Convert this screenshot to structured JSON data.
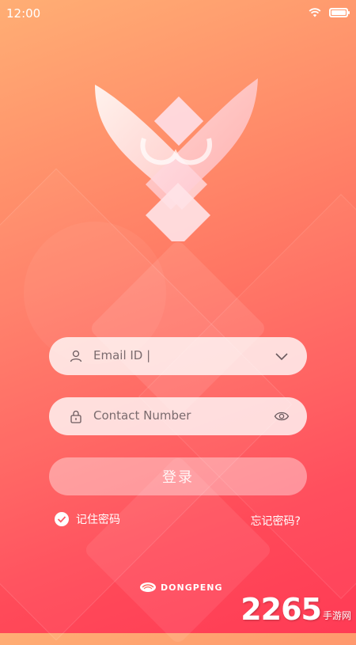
{
  "status_bar": {
    "time": "12:00"
  },
  "login": {
    "email_value": "Email ID |",
    "phone_placeholder": "Contact Number",
    "login_label": "登录",
    "remember_label": "记住密码",
    "forgot_label": "忘记密码?"
  },
  "brand": {
    "name": "DONGPENG"
  },
  "watermark": {
    "number": "2265",
    "text": "手游网"
  },
  "colors": {
    "gradient_top": "#ffae74",
    "gradient_bottom": "#ff3b55",
    "field_bg": "#ffffffc7"
  },
  "icons": [
    "wifi-icon",
    "battery-icon",
    "user-icon",
    "chevron-down-icon",
    "lock-icon",
    "eye-icon",
    "check-icon",
    "dongpeng-logo-icon"
  ]
}
